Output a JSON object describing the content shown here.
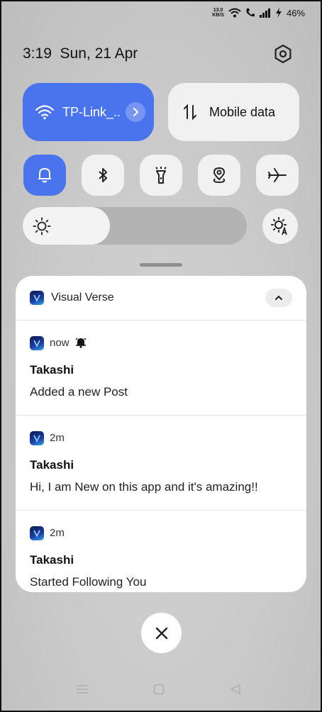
{
  "status": {
    "speed_value": "13.0",
    "speed_unit": "KB/S",
    "battery": "46%"
  },
  "header": {
    "time": "3:19",
    "date": "Sun, 21 Apr"
  },
  "tiles": {
    "wifi": {
      "label": "TP-Link_.."
    },
    "mobile": {
      "label": "Mobile data"
    }
  },
  "quick_toggles": [
    {
      "icon": "bell-icon",
      "active": true
    },
    {
      "icon": "bluetooth-icon",
      "active": false
    },
    {
      "icon": "flashlight-icon",
      "active": false
    },
    {
      "icon": "location-icon",
      "active": false
    },
    {
      "icon": "airplane-icon",
      "active": false
    }
  ],
  "brightness": {
    "level": 0.39
  },
  "notification_group": {
    "app_name": "Visual Verse",
    "items": [
      {
        "time": "now",
        "sender": "Takashi",
        "message": "Added a new Post",
        "alert_icon": true
      },
      {
        "time": "2m",
        "sender": "Takashi",
        "message": "Hi, I am New on this app and it's amazing!!",
        "alert_icon": false
      },
      {
        "time": "2m",
        "sender": "Takashi",
        "message": "Started Following You",
        "alert_icon": false
      }
    ]
  },
  "colors": {
    "accent": "#4a73ee",
    "tile_bg": "#f1f1f1",
    "card_bg": "#ffffff"
  }
}
